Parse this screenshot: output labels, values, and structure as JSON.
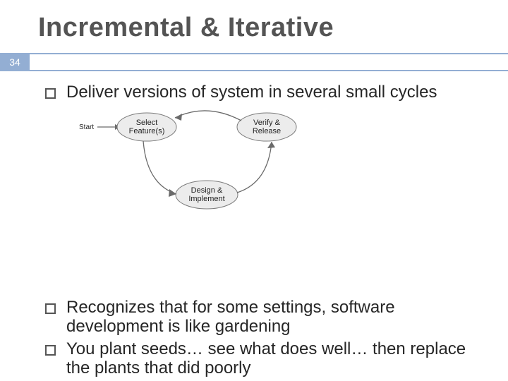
{
  "title": "Incremental & Iterative",
  "page_number": "34",
  "bullets": [
    "Deliver versions of system in several small cycles",
    "Recognizes that for some settings, software development is like gardening",
    "You plant seeds… see what does well… then replace the plants that did poorly"
  ],
  "diagram": {
    "start_label": "Start",
    "nodes": [
      {
        "line1": "Select",
        "line2": "Feature(s)"
      },
      {
        "line1": "Verify &",
        "line2": "Release"
      },
      {
        "line1": "Design &",
        "line2": "Implement"
      }
    ]
  }
}
